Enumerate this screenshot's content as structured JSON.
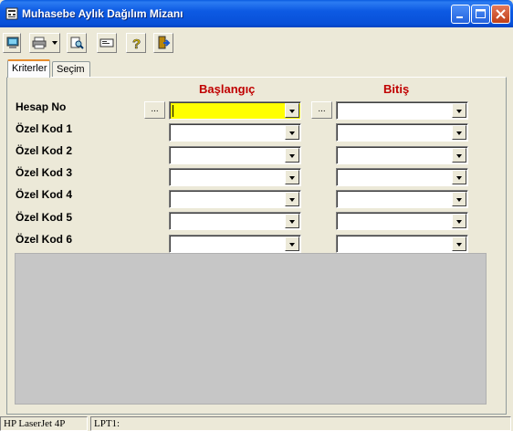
{
  "window": {
    "title": "Muhasebe Aylık Dağılım Mizanı"
  },
  "tabs": [
    {
      "label": "Kriterler",
      "active": true
    },
    {
      "label": "Seçim",
      "active": false
    }
  ],
  "columns": {
    "start": "Başlangıç",
    "end": "Bitiş"
  },
  "rows": [
    {
      "label": "Hesap No",
      "start_value": "",
      "end_value": ""
    },
    {
      "label": "Özel Kod 1",
      "start_value": "",
      "end_value": ""
    },
    {
      "label": "Özel Kod 2",
      "start_value": "",
      "end_value": ""
    },
    {
      "label": "Özel Kod 3",
      "start_value": "",
      "end_value": ""
    },
    {
      "label": "Özel Kod 4",
      "start_value": "",
      "end_value": ""
    },
    {
      "label": "Özel Kod 5",
      "start_value": "",
      "end_value": ""
    },
    {
      "label": "Özel Kod 6",
      "start_value": "",
      "end_value": ""
    }
  ],
  "browse_label": "...",
  "statusbar": {
    "printer": "HP LaserJet 4P",
    "port": "LPT1:"
  },
  "colors": {
    "header_red": "#C00000",
    "active_field": "#FFFF00",
    "grid_area": "#C6C6C6"
  },
  "icons": [
    "computer-icon",
    "printer-icon",
    "preview-icon",
    "card-icon",
    "help-icon",
    "exit-icon"
  ]
}
